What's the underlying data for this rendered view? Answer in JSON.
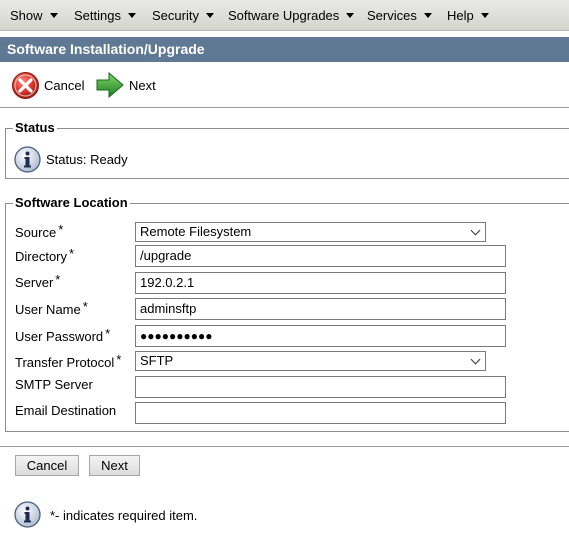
{
  "menu": {
    "items": [
      {
        "label": "Show"
      },
      {
        "label": "Settings"
      },
      {
        "label": "Security"
      },
      {
        "label": "Software Upgrades"
      },
      {
        "label": "Services"
      },
      {
        "label": "Help"
      }
    ]
  },
  "page": {
    "title": "Software Installation/Upgrade"
  },
  "toolbar": {
    "cancel_label": "Cancel",
    "next_label": "Next"
  },
  "status": {
    "legend": "Status",
    "text": "Status: Ready"
  },
  "location": {
    "legend": "Software Location",
    "required_mark": "*",
    "source": {
      "label": "Source",
      "value": "Remote Filesystem"
    },
    "directory": {
      "label": "Directory",
      "value": "/upgrade"
    },
    "server": {
      "label": "Server",
      "value": "192.0.2.1"
    },
    "user_name": {
      "label": "User Name",
      "value": "adminsftp"
    },
    "user_password": {
      "label": "User Password",
      "value": "●●●●●●●●●●"
    },
    "transfer_protocol": {
      "label": "Transfer Protocol",
      "value": "SFTP"
    },
    "smtp_server": {
      "label": "SMTP Server",
      "value": ""
    },
    "email_destination": {
      "label": "Email Destination",
      "value": ""
    }
  },
  "buttons": {
    "cancel_label": "Cancel",
    "next_label": "Next"
  },
  "footer": {
    "note": "*- indicates required item."
  },
  "colors": {
    "title_bar": "#5f7893",
    "cancel_icon": "#d9342b",
    "next_icon": "#2e9a2e"
  }
}
